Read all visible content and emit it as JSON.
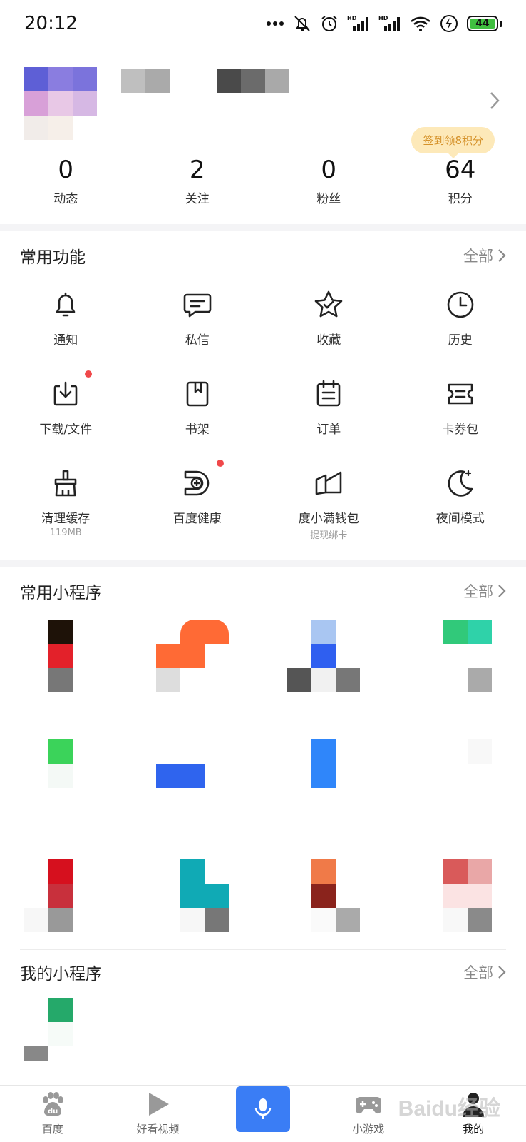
{
  "status_bar": {
    "time": "20:12",
    "battery": "44",
    "icons": [
      "more-dots-icon",
      "mute-icon",
      "alarm-icon",
      "hd-signal-icon",
      "hd-signal-icon",
      "wifi-icon",
      "charging-icon",
      "battery-icon"
    ]
  },
  "profile": {
    "sign_badge": "签到领8积分",
    "stats": [
      {
        "value": "0",
        "label": "动态"
      },
      {
        "value": "2",
        "label": "关注"
      },
      {
        "value": "0",
        "label": "粉丝"
      },
      {
        "value": "64",
        "label": "积分"
      }
    ]
  },
  "common_functions": {
    "title": "常用功能",
    "more": "全部",
    "items": [
      {
        "label": "通知",
        "icon": "bell-icon"
      },
      {
        "label": "私信",
        "icon": "message-icon"
      },
      {
        "label": "收藏",
        "icon": "star-icon"
      },
      {
        "label": "历史",
        "icon": "clock-icon"
      },
      {
        "label": "下载/文件",
        "icon": "download-icon",
        "badge": true
      },
      {
        "label": "书架",
        "icon": "book-icon"
      },
      {
        "label": "订单",
        "icon": "order-icon"
      },
      {
        "label": "卡券包",
        "icon": "coupon-icon"
      },
      {
        "label": "清理缓存",
        "icon": "broom-icon",
        "sub": "119MB"
      },
      {
        "label": "百度健康",
        "icon": "health-icon",
        "badge": true
      },
      {
        "label": "度小满钱包",
        "icon": "wallet-icon",
        "sub": "提现绑卡"
      },
      {
        "label": "夜间模式",
        "icon": "moon-icon"
      }
    ]
  },
  "common_mini_programs": {
    "title": "常用小程序",
    "more": "全部"
  },
  "my_mini_programs": {
    "title": "我的小程序",
    "more": "全部"
  },
  "bottom_nav": {
    "items": [
      {
        "label": "百度",
        "icon": "baidu-paw-icon"
      },
      {
        "label": "好看视频",
        "icon": "play-icon"
      },
      {
        "label": "",
        "icon": "microphone-icon"
      },
      {
        "label": "小游戏",
        "icon": "gamepad-icon"
      },
      {
        "label": "我的",
        "icon": "user-icon",
        "active": true
      }
    ]
  },
  "watermark": "Baidu经验",
  "colors": {
    "accent": "#3a7df5",
    "badge_red": "#f0484a",
    "sign_badge_bg": "#fde9b9",
    "sign_badge_text": "#d5922a"
  }
}
